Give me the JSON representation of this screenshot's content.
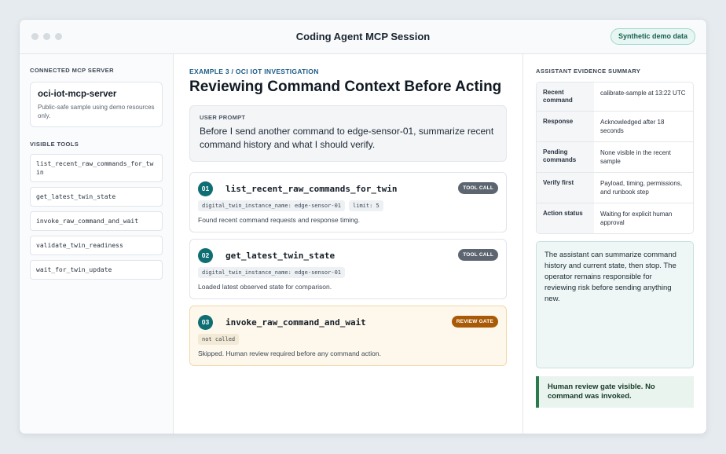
{
  "window": {
    "title": "Coding Agent MCP Session",
    "badge": "Synthetic demo data"
  },
  "sidebar": {
    "server_section_label": "CONNECTED MCP SERVER",
    "server": {
      "name": "oci-iot-mcp-server",
      "description": "Public-safe sample using demo resources only."
    },
    "tools_section_label": "VISIBLE TOOLS",
    "tools": [
      "list_recent_raw_commands_for_twin",
      "get_latest_twin_state",
      "invoke_raw_command_and_wait",
      "validate_twin_readiness",
      "wait_for_twin_update"
    ]
  },
  "main": {
    "eyebrow": "EXAMPLE 3 / OCI IOT INVESTIGATION",
    "headline": "Reviewing Command Context Before Acting",
    "prompt_label": "USER PROMPT",
    "prompt_text": "Before I send another command to edge-sensor-01, summarize recent command history and what I should verify.",
    "steps": [
      {
        "num": "01",
        "name": "list_recent_raw_commands_for_twin",
        "pill": "TOOL CALL",
        "args": [
          "digital_twin_instance_name: edge-sensor-01",
          "limit: 5"
        ],
        "result": "Found recent command requests and response timing."
      },
      {
        "num": "02",
        "name": "get_latest_twin_state",
        "pill": "TOOL CALL",
        "args": [
          "digital_twin_instance_name: edge-sensor-01"
        ],
        "result": "Loaded latest observed state for comparison."
      },
      {
        "num": "03",
        "name": "invoke_raw_command_and_wait",
        "pill": "REVIEW GATE",
        "args": [
          "not called"
        ],
        "result": "Skipped. Human review required before any command action."
      }
    ]
  },
  "evidence": {
    "label": "ASSISTANT EVIDENCE SUMMARY",
    "rows": [
      {
        "key": "Recent command",
        "value": "calibrate-sample at 13:22 UTC"
      },
      {
        "key": "Response",
        "value": "Acknowledged after 18 seconds"
      },
      {
        "key": "Pending commands",
        "value": "None visible in the recent sample"
      },
      {
        "key": "Verify first",
        "value": "Payload, timing, permissions, and runbook step"
      },
      {
        "key": "Action status",
        "value": "Waiting for explicit human approval"
      }
    ],
    "note": "The assistant can summarize command history and current state, then stop. The operator remains responsible for reviewing risk before sending anything new.",
    "banner": "Human review gate visible. No command was invoked."
  },
  "colors": {
    "accent": "#0f6e73",
    "tool_pill": "#5d6670",
    "gate_pill": "#a85a07",
    "banner_border": "#2a7a4e"
  }
}
